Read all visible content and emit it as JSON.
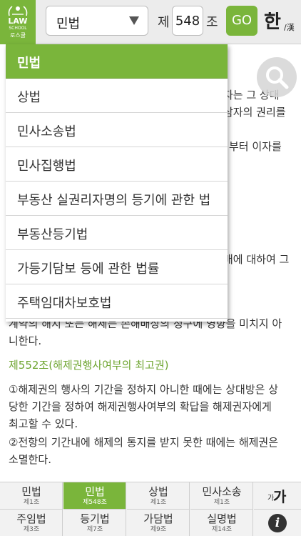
{
  "header": {
    "logo": {
      "line1": "LAW",
      "line2": "SCHOOL",
      "line3": "로스쿨"
    },
    "law_select_value": "민법",
    "article_prefix": "제",
    "article_number": "548",
    "article_suffix": "조",
    "go_label": "GO",
    "lang_toggle_main": "한",
    "lang_toggle_sub": "/漢"
  },
  "dropdown": {
    "items": [
      "민법",
      "상법",
      "민사소송법",
      "민사집행법",
      "부동산 실권리자명의 등기에 관한 법",
      "부동산등기법",
      "가등기담보 등에 관한 법률",
      "주택임대차보호법"
    ],
    "selected_index": 0
  },
  "content": {
    "partial_lines": [
      "자는 그 상대",
      "삼자의 권리를",
      "부터 이자를",
      "배에 대하여 그",
      "계약의 해지 또는 해제는 손해배상의 청구에 영향을 미치지 아",
      "니한다."
    ],
    "section_title": "제552조(해제권행사여부의 최고권)",
    "section_lines": [
      "①해제권의 행사의 기간을 정하지 아니한 때에는 상대방은 상",
      "당한 기간을 정하여 해제권행사여부의 확답을 해제권자에게",
      "최고할 수 있다.",
      "②전항의 기간내에 해제의 통지를 받지 못한 때에는 해제권은",
      "소멸한다."
    ]
  },
  "bottom_nav": {
    "row1": [
      {
        "name": "민법",
        "sub": "제1조"
      },
      {
        "name": "민법",
        "sub": "제548조"
      },
      {
        "name": "상법",
        "sub": "제1조"
      },
      {
        "name": "민사소송",
        "sub": "제1조"
      }
    ],
    "row2": [
      {
        "name": "주임법",
        "sub": "제3조"
      },
      {
        "name": "등기법",
        "sub": "제7조"
      },
      {
        "name": "가담법",
        "sub": "제9조"
      },
      {
        "name": "실명법",
        "sub": "제14조"
      }
    ],
    "active_index": 1,
    "font_size_small": "가",
    "font_size_large": "가",
    "info_label": "i"
  },
  "colors": {
    "accent_green": "#7ab53b",
    "section_title_green": "#6ea530"
  },
  "icons": {
    "search": "magnifier-icon",
    "dropdown_arrow": "triangle-down-icon",
    "info": "info-circle-icon",
    "font_size": "font-size-icon"
  }
}
